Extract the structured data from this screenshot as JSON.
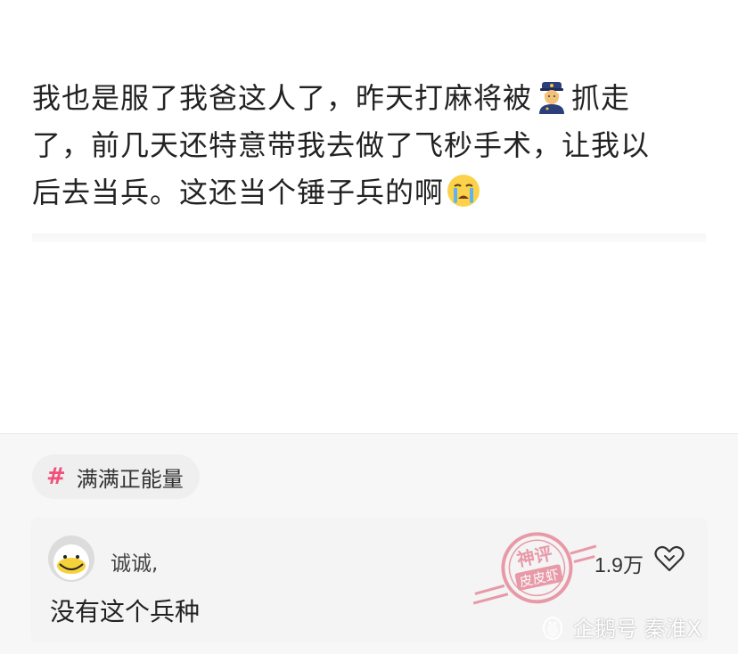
{
  "post": {
    "line1_a": "我也是服了我爸这人了，昨天打麻将被",
    "emoji1": "police-officer-emoji",
    "line1_b": "抓走",
    "line2": "了，前几天还特意带我去做了飞秒手术，让我以",
    "line3": "后去当兵。这还当个锤子兵的啊",
    "emoji2": "crying-face-emoji"
  },
  "topic": {
    "hash": "#",
    "label": "满满正能量"
  },
  "comment": {
    "username": "诚诚,",
    "text": "没有这个兵种",
    "like_count": "1.9万",
    "like_icon": "heart-icon"
  },
  "stamp": {
    "top_text": "神评",
    "bottom_text": "皮皮虾"
  },
  "watermark": {
    "text": "企鹅号 秦淮X",
    "icon": "penguin-icon"
  },
  "colors": {
    "accent": "#f0507a",
    "text": "#222222",
    "stamp": "#e0506a"
  }
}
